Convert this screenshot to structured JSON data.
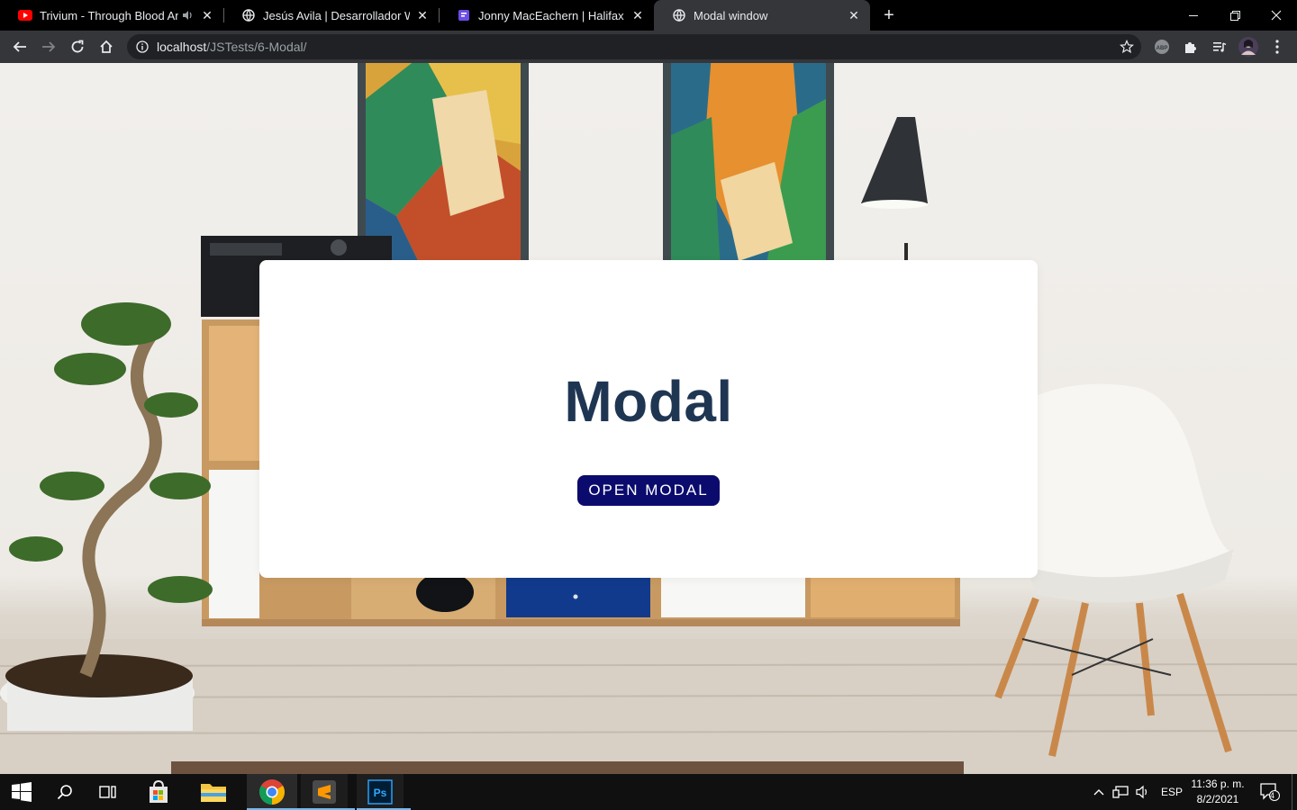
{
  "browser": {
    "tabs": [
      {
        "title": "Trivium - Through Blood And",
        "favicon": "youtube-icon",
        "audio": true,
        "active": false
      },
      {
        "title": "Jesús Avila | Desarrollador Web",
        "favicon": "globe-icon",
        "audio": false,
        "active": false
      },
      {
        "title": "Jonny MacEachern | Halifax Word",
        "favicon": "page-icon",
        "audio": false,
        "active": false
      },
      {
        "title": "Modal window",
        "favicon": "globe-icon",
        "audio": false,
        "active": true
      }
    ],
    "address": {
      "host": "localhost",
      "path": "/JSTests/6-Modal/"
    },
    "extensions": [
      "abp-icon",
      "puzzle-icon",
      "media-queue-icon",
      "profile-avatar"
    ]
  },
  "page": {
    "modal": {
      "title": "Modal",
      "button_label": "OPEN MODAL"
    },
    "colors": {
      "title": "#1f3653",
      "button": "#0b0b6e"
    }
  },
  "taskbar": {
    "apps": [
      "start-icon",
      "search-icon",
      "task-view-icon",
      "store-icon",
      "file-explorer-icon",
      "chrome-icon",
      "sublime-icon",
      "photoshop-icon"
    ],
    "language": "ESP",
    "time": "11:36 p. m.",
    "date": "8/2/2021",
    "notifications": "4"
  }
}
